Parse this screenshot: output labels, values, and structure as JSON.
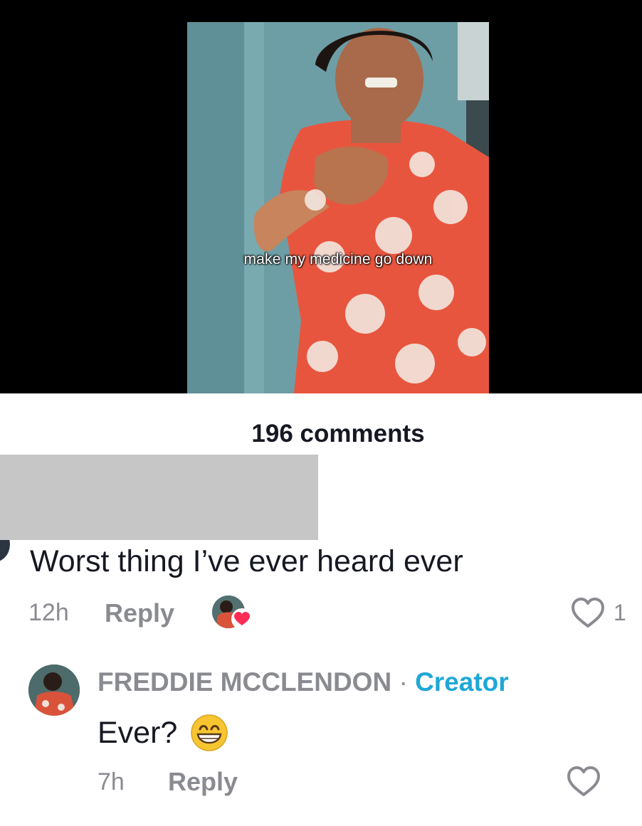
{
  "video": {
    "caption": "make my medicine go down"
  },
  "comments_header": {
    "count_label": "196 comments"
  },
  "comment": {
    "text": "Worst thing I’ve ever heard ever",
    "time": "12h",
    "reply_label": "Reply",
    "creator_liked": true,
    "like_count": "1",
    "heart_icon": "heart-outline-icon"
  },
  "reply": {
    "author": "FREDDIE MCCLENDON",
    "separator": "·",
    "badge": "Creator",
    "text": "Ever?",
    "emoji": "grinning-face-icon",
    "time": "7h",
    "reply_label": "Reply"
  },
  "colors": {
    "creator_badge": "#1ea8d6",
    "muted_text": "#8a8b91",
    "liked_heart": "#fe2c55"
  }
}
